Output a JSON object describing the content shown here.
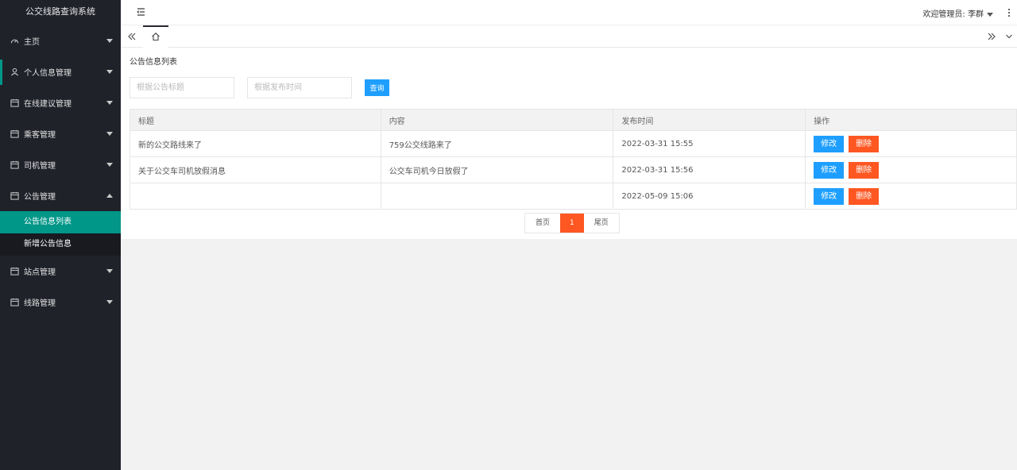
{
  "app": {
    "title": "公交线路查询系统"
  },
  "sidebar": {
    "items": [
      {
        "label": "主页",
        "icon": "dashboard-icon"
      },
      {
        "label": "个人信息管理",
        "icon": "user-icon"
      },
      {
        "label": "在线建议管理",
        "icon": "calendar-icon"
      },
      {
        "label": "乘客管理",
        "icon": "calendar-icon"
      },
      {
        "label": "司机管理",
        "icon": "calendar-icon"
      },
      {
        "label": "公告管理",
        "icon": "calendar-icon"
      },
      {
        "label": "站点管理",
        "icon": "calendar-icon"
      },
      {
        "label": "线路管理",
        "icon": "calendar-icon"
      }
    ],
    "sub_items": [
      {
        "label": "公告信息列表"
      },
      {
        "label": "新增公告信息"
      }
    ]
  },
  "header": {
    "user_label": "欢迎管理员: 李群"
  },
  "page": {
    "title": "公告信息列表",
    "search_title_placeholder": "根据公告标题",
    "search_time_placeholder": "根据发布时间",
    "search_button": "查询"
  },
  "table": {
    "headers": [
      "标题",
      "内容",
      "发布时间",
      "操作"
    ],
    "rows": [
      {
        "title": "新的公交路线来了",
        "content": "759公交线路来了",
        "time": "2022-03-31 15:55"
      },
      {
        "title": "关于公交车司机放假消息",
        "content": "公交车司机今日放假了",
        "time": "2022-03-31 15:56"
      },
      {
        "title": "",
        "content": "",
        "time": "2022-05-09 15:06"
      }
    ],
    "edit_label": "修改",
    "delete_label": "删除"
  },
  "pager": {
    "first": "首页",
    "current": "1",
    "last": "尾页"
  },
  "colors": {
    "sidebar_bg": "#20222a",
    "accent": "#009688",
    "primary": "#1e9fff",
    "danger": "#ff5722"
  }
}
